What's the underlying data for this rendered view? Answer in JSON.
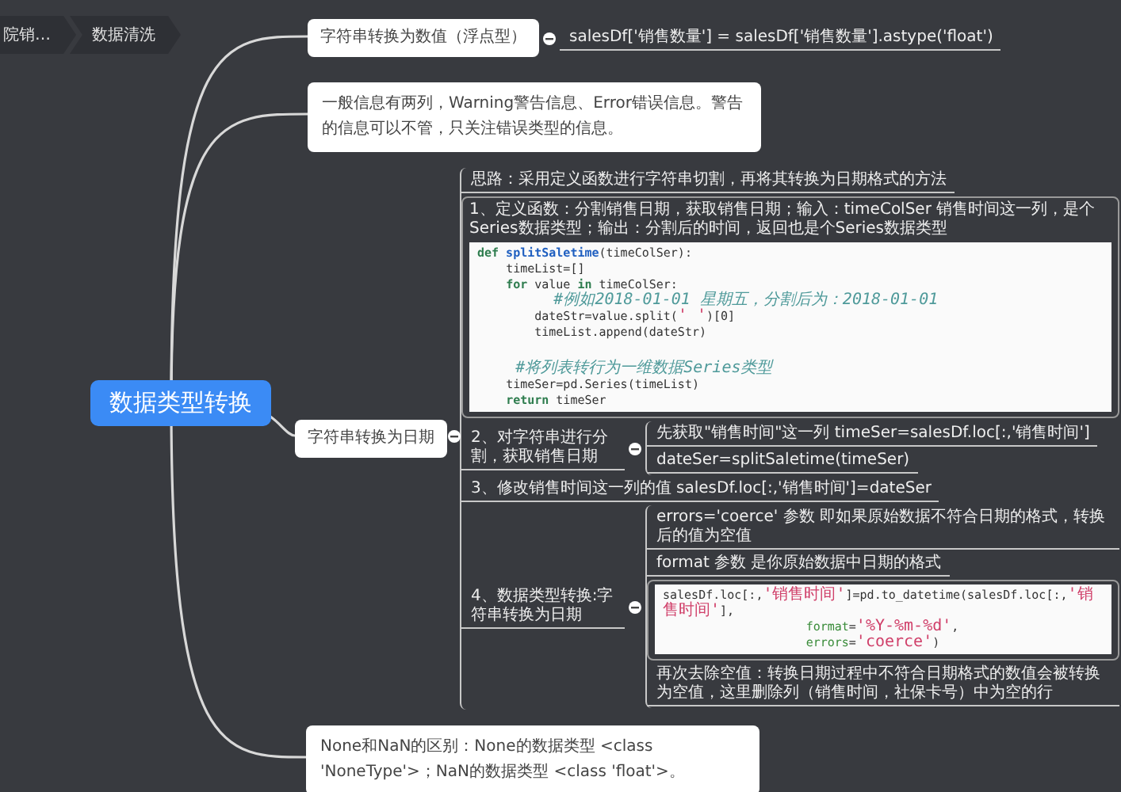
{
  "breadcrumb": [
    {
      "label": "院销…"
    },
    {
      "label": "数据清洗"
    }
  ],
  "root": {
    "label": "数据类型转换"
  },
  "branches": [
    {
      "label": "字符串转换为数值（浮点型）",
      "children": [
        {
          "kind": "text",
          "text": "salesDf['销售数量'] = salesDf['销售数量'].astype('float')"
        }
      ]
    },
    {
      "label": "一般信息有两列，Warning警告信息、Error错误信息。警告的信息可以不管，只关注错误类型的信息。"
    },
    {
      "label": "字符串转换为日期",
      "children": [
        {
          "kind": "text",
          "text": "思路：采用定义函数进行字符串切割，再将其转换为日期格式的方法"
        },
        {
          "kind": "box",
          "text": "1、定义函数：分割销售日期，获取销售日期；输入：timeColSer 销售时间这一列，是个Series数据类型；输出：分割后的时间，返回也是个Series数据类型",
          "code": [
            [
              {
                "kind": "keyword",
                "text": "def"
              },
              {
                "kind": "function",
                "text": " splitSaletime"
              },
              {
                "kind": "plain",
                "text": "(timeColSer):"
              }
            ],
            [
              {
                "kind": "plain",
                "text": "    timeList=[]"
              }
            ],
            [
              {
                "kind": "keyword",
                "text": "    for"
              },
              {
                "kind": "plain",
                "text": " value "
              },
              {
                "kind": "keyword",
                "text": "in"
              },
              {
                "kind": "plain",
                "text": " timeColSer:"
              }
            ],
            [
              {
                "kind": "comment",
                "text": "        #例如2018-01-01 星期五，分割后为：2018-01-01"
              }
            ],
            [
              {
                "kind": "plain",
                "text": "        dateStr=value.split("
              },
              {
                "kind": "string",
                "text": "' '"
              },
              {
                "kind": "plain",
                "text": ")[0]"
              }
            ],
            [
              {
                "kind": "plain",
                "text": "        timeList.append(dateStr)"
              }
            ],
            [
              {
                "kind": "blank"
              }
            ],
            [
              {
                "kind": "comment",
                "text": "    #将列表转行为一维数据Series类型"
              }
            ],
            [
              {
                "kind": "plain",
                "text": "    timeSer=pd.Series(timeList)"
              }
            ],
            [
              {
                "kind": "keyword",
                "text": "    return"
              },
              {
                "kind": "plain",
                "text": " timeSer"
              }
            ]
          ]
        },
        {
          "kind": "text",
          "text": "2、对字符串进行分割，获取销售日期",
          "children": [
            {
              "kind": "text",
              "text": "先获取\"销售时间\"这一列 timeSer=salesDf.loc[:,'销售时间']"
            },
            {
              "kind": "text",
              "text": "dateSer=splitSaletime(timeSer)"
            }
          ]
        },
        {
          "kind": "text",
          "text": "3、修改销售时间这一列的值 salesDf.loc[:,'销售时间']=dateSer"
        },
        {
          "kind": "text",
          "text": "4、数据类型转换:字符串转换为日期",
          "children": [
            {
              "kind": "text",
              "text": "errors='coerce' 参数 即如果原始数据不符合日期的格式，转换后的值为空值"
            },
            {
              "kind": "text",
              "text": "format 参数 是你原始数据中日期的格式"
            },
            {
              "kind": "box",
              "code": [
                [
                  {
                    "kind": "plain",
                    "text": "salesDf.loc[:,"
                  },
                  {
                    "kind": "string",
                    "text": "'销售时间'"
                  },
                  {
                    "kind": "plain",
                    "text": "]=pd.to_datetime(salesDf.loc[:,"
                  },
                  {
                    "kind": "string",
                    "text": "'销售时间'"
                  },
                  {
                    "kind": "plain",
                    "text": "],"
                  }
                ],
                [
                  {
                    "kind": "param",
                    "text": "                    format"
                  },
                  {
                    "kind": "plain",
                    "text": "="
                  },
                  {
                    "kind": "string",
                    "text": "'%Y-%m-%d'"
                  },
                  {
                    "kind": "plain",
                    "text": ","
                  }
                ],
                [
                  {
                    "kind": "param",
                    "text": "                    errors"
                  },
                  {
                    "kind": "plain",
                    "text": "="
                  },
                  {
                    "kind": "string",
                    "text": "'coerce'"
                  },
                  {
                    "kind": "plain",
                    "text": ")"
                  }
                ]
              ]
            },
            {
              "kind": "text",
              "text": "再次去除空值：转换日期过程中不符合日期格式的数值会被转换为空值，这里删除列（销售时间，社保卡号）中为空的行"
            }
          ]
        }
      ]
    },
    {
      "label": "None和NaN的区别：None的数据类型 <class 'NoneType'>；NaN的数据类型 <class 'float'>。"
    }
  ]
}
